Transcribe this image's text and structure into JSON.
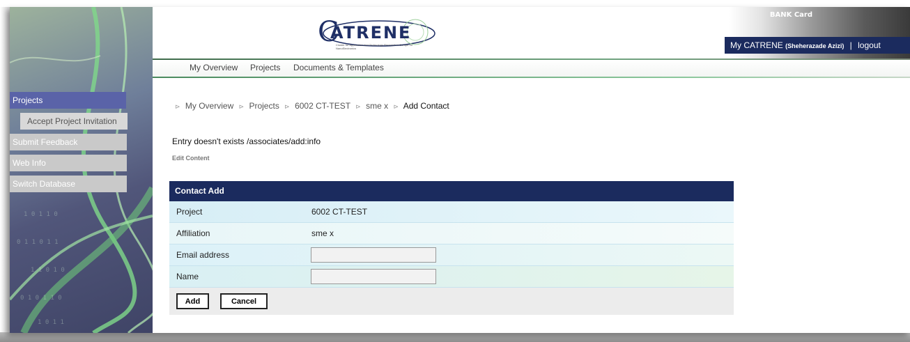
{
  "header": {
    "logo_text": "ATRENE",
    "logo_initial": "C",
    "logo_tagline": "Cluster for Application and Technology Research in Europe on NanoElectronics",
    "bank_card_label": "BANK Card",
    "user_prefix": "My CATRENE",
    "user_name": "(Sheherazade Azizi)",
    "separator": "|",
    "logout": "logout"
  },
  "topnav": {
    "items": [
      {
        "label": "My Overview"
      },
      {
        "label": "Projects"
      },
      {
        "label": "Documents & Templates"
      }
    ]
  },
  "sidebar": {
    "items": [
      {
        "label": "Projects",
        "active": true
      },
      {
        "label": "Accept Project Invitation"
      },
      {
        "label": "Submit Feedback"
      },
      {
        "label": "Web Info"
      },
      {
        "label": "Switch Database"
      }
    ]
  },
  "breadcrumb": {
    "separator": "⊳",
    "items": [
      "My Overview",
      "Projects",
      "6002 CT-TEST",
      "sme x"
    ],
    "current": "Add Contact"
  },
  "content": {
    "entry_message": "Entry doesn't exists /associates/add:info",
    "edit_content": "Edit Content"
  },
  "form": {
    "title": "Contact Add",
    "rows": [
      {
        "label": "Project",
        "value": "6002 CT-TEST"
      },
      {
        "label": "Affiliation",
        "value": "sme x"
      },
      {
        "label": "Email address",
        "value": ""
      },
      {
        "label": "Name",
        "value": ""
      }
    ],
    "add_label": "Add",
    "cancel_label": "Cancel"
  },
  "colors": {
    "navy": "#1b2b5e",
    "active_menu": "#5a63a8",
    "accent_green": "#4a8a5e"
  }
}
